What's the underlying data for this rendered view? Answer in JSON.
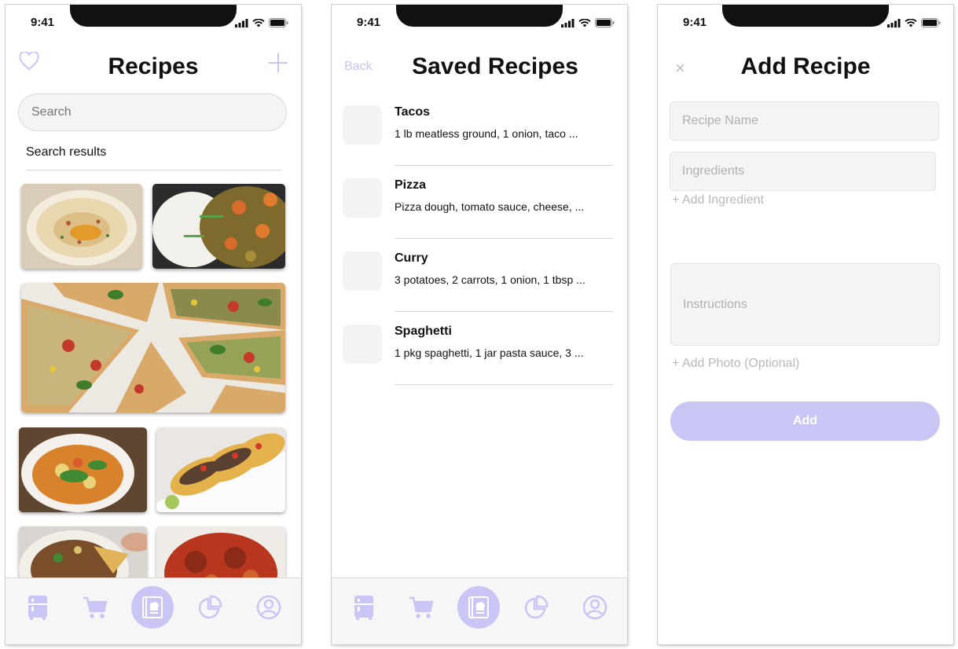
{
  "colors": {
    "accent": "#c9c5f5",
    "text": "#111111",
    "placeholder": "#b0b0b0",
    "field_bg": "#f4f4f4"
  },
  "status_bar": {
    "time": "9:41"
  },
  "recipes_screen": {
    "title": "Recipes",
    "favorite_icon": "heart-icon",
    "add_icon": "plus-icon",
    "search": {
      "placeholder": "Search"
    },
    "results_label": "Search results",
    "photos": [
      "hummus",
      "curry-with-rice",
      "pizza",
      "soup",
      "tacos",
      "nachos",
      "spaghetti-meatballs"
    ]
  },
  "saved_screen": {
    "back_label": "Back",
    "title": "Saved Recipes",
    "items": [
      {
        "name": "Tacos",
        "ingredients": "1 lb meatless ground, 1 onion, taco ..."
      },
      {
        "name": "Pizza",
        "ingredients": "Pizza dough, tomato sauce, cheese, ..."
      },
      {
        "name": "Curry",
        "ingredients": "3 potatoes, 2 carrots, 1 onion, 1 tbsp ..."
      },
      {
        "name": "Spaghetti",
        "ingredients": "1 pkg spaghetti, 1 jar pasta sauce, 3 ..."
      }
    ]
  },
  "add_screen": {
    "close_label": "×",
    "title": "Add Recipe",
    "recipe_name_placeholder": "Recipe Name",
    "ingredients_placeholder": "Ingredients",
    "add_ingredient_label": "+ Add Ingredient",
    "instructions_placeholder": "Instructions",
    "add_photo_label": "+ Add Photo (Optional)",
    "add_button_label": "Add"
  },
  "tab_bar": {
    "tabs": [
      {
        "icon": "fridge-icon",
        "active": false
      },
      {
        "icon": "cart-icon",
        "active": false
      },
      {
        "icon": "cookbook-icon",
        "active": true
      },
      {
        "icon": "pie-chart-icon",
        "active": false
      },
      {
        "icon": "profile-icon",
        "active": false
      }
    ]
  }
}
